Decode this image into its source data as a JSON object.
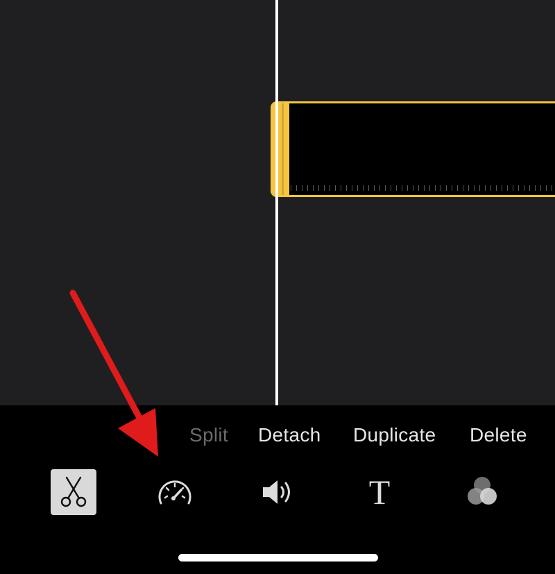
{
  "actions": {
    "split": "Split",
    "detach": "Detach",
    "duplicate": "Duplicate",
    "delete": "Delete"
  },
  "tools": {
    "text_glyph": "T"
  },
  "icons": {
    "cut": "scissors-icon",
    "speed": "speedometer-icon",
    "volume": "speaker-icon",
    "titles": "text-icon",
    "filters": "filters-circles-icon"
  },
  "colors": {
    "clip_border": "#f6c43f",
    "timeline_bg": "#1f1f21",
    "toolbar_bg": "#000000",
    "annotation_arrow": "#e01b1b"
  }
}
